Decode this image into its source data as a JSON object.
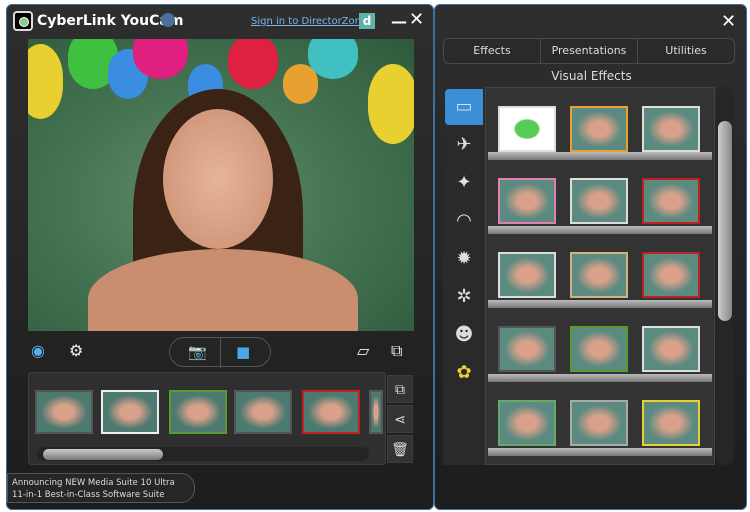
{
  "left_window": {
    "title": "CyberLink YouCam",
    "sign_in_link": "Sign in to DirectorZone",
    "directorzone_icon": "d",
    "minimize": "—",
    "close": "✕",
    "toolbar": {
      "eye_icon": "◉",
      "settings_icon": "⚙",
      "camera_icon": "📷",
      "video_icon": "■",
      "eraser_icon": "▱",
      "window_icon": "⧉"
    },
    "thumbnails": [
      "circle-frame",
      "stacked-photos",
      "green-frame",
      "sparkles",
      "red-rose-frame"
    ],
    "side_actions": {
      "copy": "⧉",
      "share": "⋖",
      "delete": "🗑"
    },
    "news": [
      "Announcing NEW Media Suite 10 Ultra",
      "11-in-1 Best-in-Class Software Suite"
    ]
  },
  "right_window": {
    "close": "✕",
    "tabs": [
      "Effects",
      "Presentations",
      "Utilities"
    ],
    "section_title": "Visual Effects",
    "categories": [
      "▭",
      "✈",
      "✦",
      "◠",
      "✹",
      "✲",
      "☻",
      "✿"
    ],
    "accent": "#3a8fd8"
  }
}
